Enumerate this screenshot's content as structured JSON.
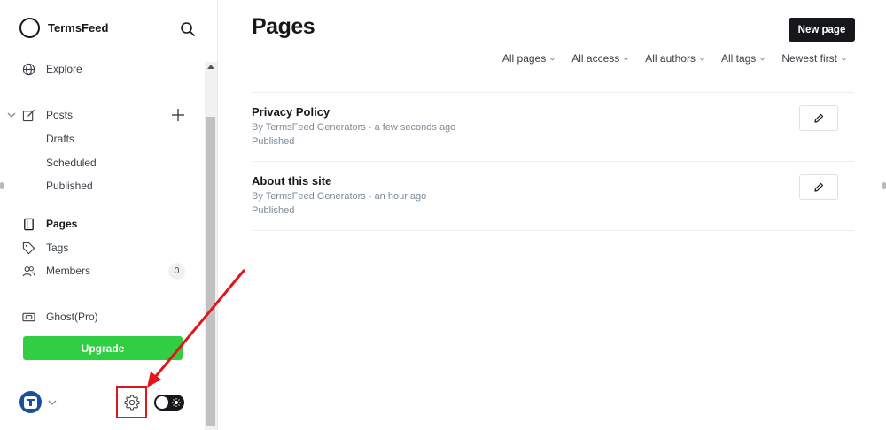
{
  "sidebar": {
    "brand": "TermsFeed",
    "nav": {
      "explore": "Explore",
      "posts": "Posts",
      "drafts": "Drafts",
      "scheduled": "Scheduled",
      "published": "Published",
      "pages": "Pages",
      "tags": "Tags",
      "members": "Members",
      "members_count": "0",
      "ghost_pro": "Ghost(Pro)"
    },
    "upgrade_label": "Upgrade"
  },
  "main": {
    "title": "Pages",
    "new_page_label": "New page",
    "filters": [
      "All pages",
      "All access",
      "All authors",
      "All tags",
      "Newest first"
    ],
    "items": [
      {
        "title": "Privacy Policy",
        "meta": "By TermsFeed Generators - a few seconds ago",
        "status": "Published"
      },
      {
        "title": "About this site",
        "meta": "By TermsFeed Generators - an hour ago",
        "status": "Published"
      }
    ]
  },
  "colors": {
    "accent_green": "#30cf43",
    "annotation_red": "#e2151a",
    "primary_dark": "#15171a"
  }
}
